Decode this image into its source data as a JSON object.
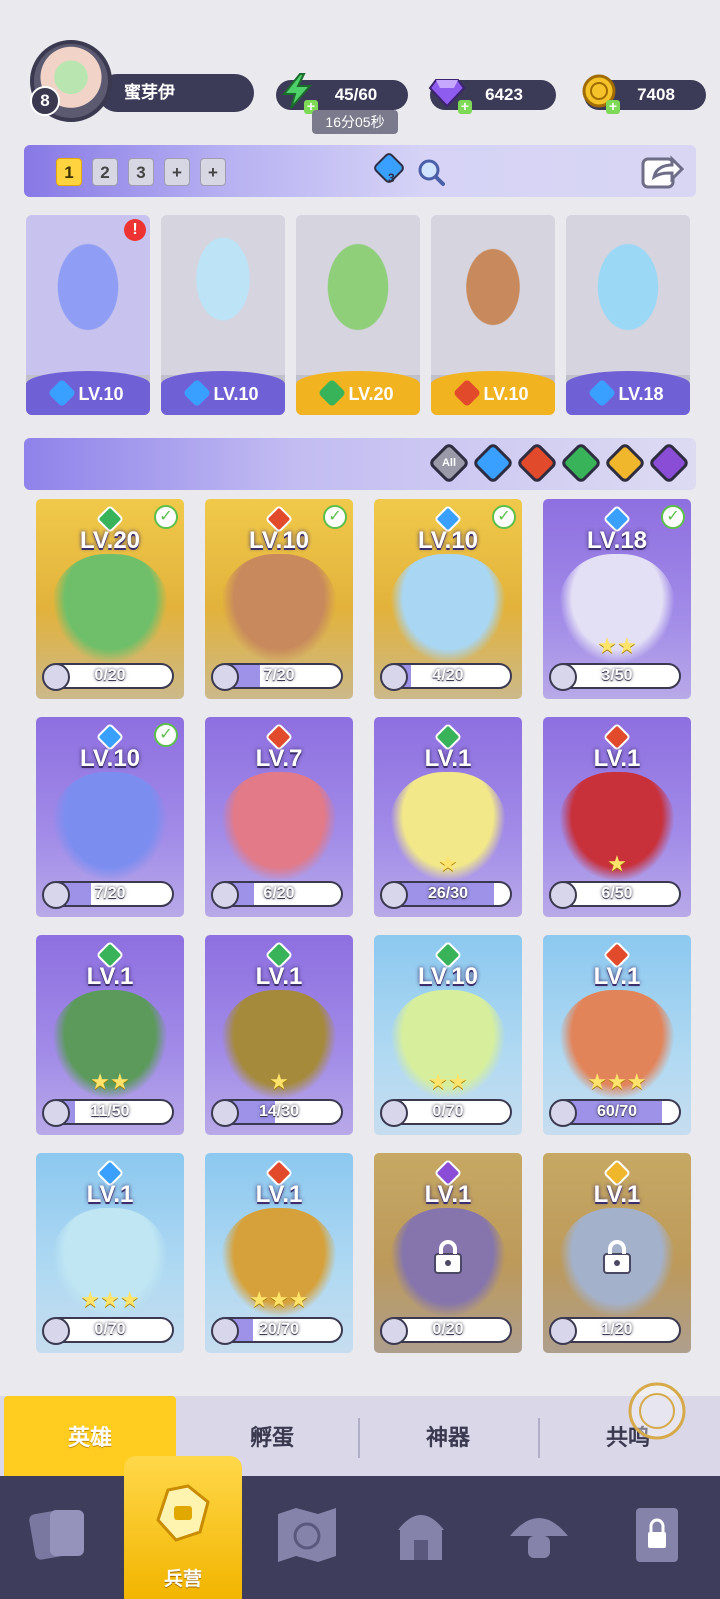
{
  "player": {
    "level": "8",
    "name": "蜜芽伊",
    "energy": "45/60",
    "energy_timer": "16分05秒",
    "gems": "6423",
    "coins": "7408"
  },
  "team": {
    "slots": [
      "1",
      "2",
      "3"
    ],
    "active_slot": "1",
    "add_labels": [
      "+",
      "+"
    ],
    "gem_badge": "3"
  },
  "selected_heroes": [
    {
      "element": "water",
      "level": "LV.10",
      "alert": "!"
    },
    {
      "element": "water",
      "level": "LV.10"
    },
    {
      "element": "grass",
      "level": "LV.20"
    },
    {
      "element": "fire",
      "level": "LV.10"
    },
    {
      "element": "water",
      "level": "LV.18"
    }
  ],
  "filters": {
    "all_label": "All",
    "elements": [
      "water-icon",
      "fire-icon",
      "grass-icon",
      "light-icon",
      "dark-icon"
    ]
  },
  "heroes": [
    {
      "element": "grass",
      "level": "LV.20",
      "progress": "0/20",
      "frac": 0.0,
      "owned": true,
      "bg": "gold",
      "portrait": "#6fbf6a"
    },
    {
      "element": "fire",
      "level": "LV.10",
      "progress": "7/20",
      "frac": 0.35,
      "owned": true,
      "bg": "gold",
      "portrait": "#c88a5c"
    },
    {
      "element": "water",
      "level": "LV.10",
      "progress": "4/20",
      "frac": 0.2,
      "owned": true,
      "bg": "gold",
      "portrait": "#a9d6f2"
    },
    {
      "element": "water",
      "level": "LV.18",
      "progress": "3/50",
      "frac": 0.06,
      "owned": true,
      "bg": "purple",
      "portrait": "#e3dff5",
      "stars": "★★"
    },
    {
      "element": "water",
      "level": "LV.10",
      "progress": "7/20",
      "frac": 0.35,
      "owned": true,
      "bg": "purple",
      "portrait": "#7b8ef0"
    },
    {
      "element": "fire",
      "level": "LV.7",
      "progress": "6/20",
      "frac": 0.3,
      "owned": false,
      "bg": "purple",
      "portrait": "#e27a88"
    },
    {
      "element": "grass",
      "level": "LV.1",
      "progress": "26/30",
      "frac": 0.87,
      "owned": false,
      "bg": "purple",
      "portrait": "#f2e88a",
      "stars": "★"
    },
    {
      "element": "fire",
      "level": "LV.1",
      "progress": "6/50",
      "frac": 0.12,
      "owned": false,
      "bg": "purple",
      "portrait": "#c8303a",
      "stars": "★"
    },
    {
      "element": "grass",
      "level": "LV.1",
      "progress": "11/50",
      "frac": 0.22,
      "owned": false,
      "bg": "purple",
      "portrait": "#5b9a5b",
      "stars": "★★"
    },
    {
      "element": "grass",
      "level": "LV.1",
      "progress": "14/30",
      "frac": 0.47,
      "owned": false,
      "bg": "purple",
      "portrait": "#a58a3c",
      "stars": "★"
    },
    {
      "element": "grass",
      "level": "LV.10",
      "progress": "0/70",
      "frac": 0.0,
      "owned": false,
      "bg": "blue",
      "portrait": "#d7ef9c",
      "stars": "★★"
    },
    {
      "element": "fire",
      "level": "LV.1",
      "progress": "60/70",
      "frac": 0.86,
      "owned": false,
      "bg": "blue",
      "portrait": "#e2845a",
      "stars": "★★★"
    },
    {
      "element": "water",
      "level": "LV.1",
      "progress": "0/70",
      "frac": 0.0,
      "owned": false,
      "bg": "blue",
      "portrait": "#bfe6f2",
      "stars": "★★★"
    },
    {
      "element": "fire",
      "level": "LV.1",
      "progress": "20/70",
      "frac": 0.29,
      "owned": false,
      "bg": "blue",
      "portrait": "#d6a13a",
      "stars": "★★★"
    },
    {
      "element": "dark",
      "level": "LV.1",
      "progress": "0/20",
      "frac": 0.0,
      "owned": false,
      "bg": "gold",
      "portrait": "#8c7ab8",
      "locked": true
    },
    {
      "element": "light",
      "level": "LV.1",
      "progress": "1/20",
      "frac": 0.05,
      "owned": false,
      "bg": "gold",
      "portrait": "#bcd6e6",
      "locked": true
    }
  ],
  "sub_tabs": [
    "英雄",
    "孵蛋",
    "神器",
    "共鸣"
  ],
  "active_sub_tab": "英雄",
  "nav": {
    "active_label": "兵营",
    "items": [
      "cards-icon",
      "barracks-icon",
      "map-icon",
      "temple-icon",
      "mushroom-icon",
      "locked-banner-icon"
    ]
  },
  "colors": {
    "accent_yellow": "#ffcc1f",
    "dark_panel": "#3e3d5c",
    "water": "#3aa0ff",
    "fire": "#e24a2c",
    "grass": "#39b35a",
    "light": "#f0b72c",
    "dark": "#8a4dd6"
  }
}
